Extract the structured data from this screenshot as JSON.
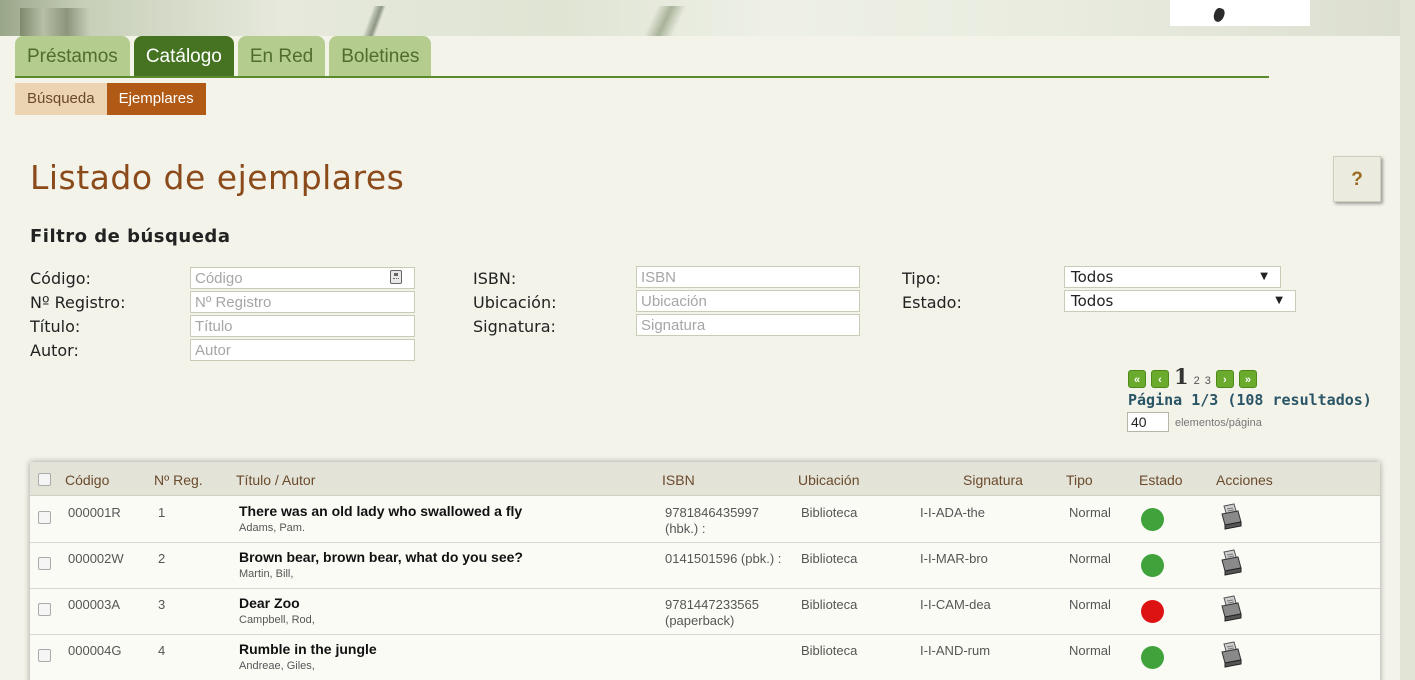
{
  "colors": {
    "status_available": "#3fa23b",
    "status_unavailable": "#dd1313",
    "tab_active": "#467322",
    "subtab_active": "#b05a16"
  },
  "main_tabs": [
    "Préstamos",
    "Catálogo",
    "En Red",
    "Boletines"
  ],
  "main_tab_active": "Catálogo",
  "sub_tabs": [
    "Búsqueda",
    "Ejemplares"
  ],
  "sub_tab_active": "Ejemplares",
  "page_title": "Listado de ejemplares",
  "help_label": "?",
  "filter": {
    "title": "Filtro de búsqueda",
    "codigo_label": "Código:",
    "codigo_placeholder": "Código",
    "registro_label": "Nº Registro:",
    "registro_placeholder": "Nº Registro",
    "titulo_label": "Título:",
    "titulo_placeholder": "Título",
    "autor_label": "Autor:",
    "autor_placeholder": "Autor",
    "isbn_label": "ISBN:",
    "isbn_placeholder": "ISBN",
    "ubicacion_label": "Ubicación:",
    "ubicacion_placeholder": "Ubicación",
    "signatura_label": "Signatura:",
    "signatura_placeholder": "Signatura",
    "tipo_label": "Tipo:",
    "tipo_value": "Todos",
    "estado_label": "Estado:",
    "estado_value": "Todos"
  },
  "pagination": {
    "current_page": "1",
    "other_pages": [
      "2",
      "3"
    ],
    "info": "Página 1/3 (108 resultados)",
    "per_page_value": "40",
    "per_page_label": "elementos/página"
  },
  "table": {
    "headers": [
      "Código",
      "Nº Reg.",
      "Título / Autor",
      "ISBN",
      "Ubicación",
      "Signatura",
      "Tipo",
      "Estado",
      "Acciones"
    ],
    "rows": [
      {
        "codigo": "000001R",
        "registro": "1",
        "titulo": "There was an old lady who swallowed a fly",
        "autor": "Adams, Pam.",
        "isbn_1": "9781846435997",
        "isbn_2": "(hbk.) :",
        "ubicacion": "Biblioteca",
        "signatura": "I-I-ADA-the",
        "tipo": "Normal",
        "estado": "available"
      },
      {
        "codigo": "000002W",
        "registro": "2",
        "titulo": "Brown bear, brown bear, what do you see?",
        "autor": "Martin, Bill,",
        "isbn_1": "0141501596 (pbk.) :",
        "isbn_2": "",
        "ubicacion": "Biblioteca",
        "signatura": "I-I-MAR-bro",
        "tipo": "Normal",
        "estado": "available"
      },
      {
        "codigo": "000003A",
        "registro": "3",
        "titulo": "Dear Zoo",
        "autor": "Campbell, Rod,",
        "isbn_1": "9781447233565",
        "isbn_2": "(paperback)",
        "ubicacion": "Biblioteca",
        "signatura": "I-I-CAM-dea",
        "tipo": "Normal",
        "estado": "unavailable"
      },
      {
        "codigo": "000004G",
        "registro": "4",
        "titulo": "Rumble in the jungle",
        "autor": "Andreae, Giles,",
        "isbn_1": "",
        "isbn_2": "",
        "ubicacion": "Biblioteca",
        "signatura": "I-I-AND-rum",
        "tipo": "Normal",
        "estado": "available"
      }
    ]
  },
  "icons": {
    "pager_first": "first-page-icon",
    "pager_prev": "previous-page-icon",
    "pager_next": "next-page-icon",
    "pager_last": "last-page-icon",
    "row_action": "printer-icon",
    "codigo_input": "calculator-icon"
  }
}
